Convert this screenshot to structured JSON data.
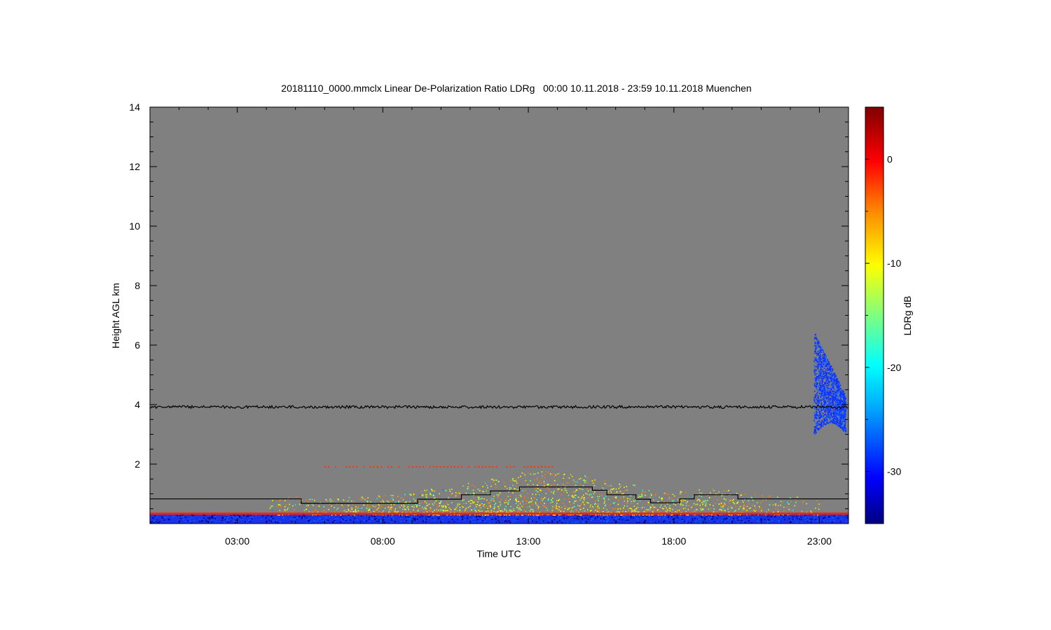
{
  "chart_data": {
    "type": "heatmap",
    "title": "20181110_0000.mmclx Linear De-Polarization Ratio LDRg   00:00 10.11.2018 - 23:59 10.11.2018 Muenchen",
    "xlabel": "Time UTC",
    "ylabel": "Height AGL km",
    "colorbar_label": "LDRg dB",
    "x_unit": "hours UTC",
    "xlim": [
      0,
      24
    ],
    "ylim": [
      0,
      14
    ],
    "x_ticks": [
      {
        "value": 3,
        "label": "03:00"
      },
      {
        "value": 8,
        "label": "08:00"
      },
      {
        "value": 13,
        "label": "13:00"
      },
      {
        "value": 18,
        "label": "18:00"
      },
      {
        "value": 23,
        "label": "23:00"
      }
    ],
    "y_ticks": [
      {
        "value": 2,
        "label": "2"
      },
      {
        "value": 4,
        "label": "4"
      },
      {
        "value": 6,
        "label": "6"
      },
      {
        "value": 8,
        "label": "8"
      },
      {
        "value": 10,
        "label": "10"
      },
      {
        "value": 12,
        "label": "12"
      },
      {
        "value": 14,
        "label": "14"
      }
    ],
    "colorbar_range": [
      -35,
      5
    ],
    "colorbar_ticks": [
      {
        "value": 0,
        "label": "0"
      },
      {
        "value": -10,
        "label": "-10"
      },
      {
        "value": -20,
        "label": "-20"
      },
      {
        "value": -30,
        "label": "-30"
      }
    ],
    "background_color": "#808080",
    "colormap": [
      "#00007f",
      "#0000ff",
      "#007fff",
      "#00ffff",
      "#7fff7f",
      "#ffff00",
      "#ff7f00",
      "#ff0000",
      "#7f0000"
    ],
    "noise_line": {
      "height_km": 3.92,
      "color": "#000000"
    },
    "boundary_layer_height": {
      "color": "#000000",
      "points": [
        [
          0,
          0.83
        ],
        [
          5.2,
          0.83
        ],
        [
          5.2,
          0.68
        ],
        [
          9.2,
          0.68
        ],
        [
          9.2,
          0.82
        ],
        [
          10.7,
          0.82
        ],
        [
          10.7,
          0.97
        ],
        [
          11.7,
          0.97
        ],
        [
          11.7,
          1.1
        ],
        [
          12.7,
          1.1
        ],
        [
          12.7,
          1.23
        ],
        [
          15.2,
          1.23
        ],
        [
          15.2,
          1.12
        ],
        [
          15.7,
          1.12
        ],
        [
          15.7,
          0.97
        ],
        [
          16.7,
          0.97
        ],
        [
          16.7,
          0.82
        ],
        [
          17.2,
          0.82
        ],
        [
          17.2,
          0.7
        ],
        [
          18.2,
          0.7
        ],
        [
          18.2,
          0.83
        ],
        [
          18.7,
          0.83
        ],
        [
          18.7,
          0.97
        ],
        [
          20.2,
          0.97
        ],
        [
          20.2,
          0.83
        ],
        [
          24,
          0.83
        ]
      ]
    },
    "layers": [
      {
        "name": "near-surface",
        "x_range": [
          0,
          24
        ],
        "height_range": [
          0.05,
          0.35
        ],
        "ldr_db": -30
      },
      {
        "name": "surface-red-band",
        "x_range": [
          0,
          24
        ],
        "height_range": [
          0.3,
          0.37
        ],
        "ldr_db": 0
      },
      {
        "name": "daytime-aerosol",
        "x_range": [
          4,
          23
        ],
        "height_range": [
          0.05,
          1.9
        ],
        "ldr_db_range": [
          -15,
          -5
        ],
        "peak_time": 13.5
      },
      {
        "name": "elevated-red-layer",
        "x_range": [
          6,
          14
        ],
        "height_range": [
          1.88,
          1.93
        ],
        "ldr_db": 0
      },
      {
        "name": "cloud",
        "x_range": [
          22.8,
          23.9
        ],
        "height_range": [
          3.0,
          6.5
        ],
        "ldr_db": -28
      }
    ]
  }
}
